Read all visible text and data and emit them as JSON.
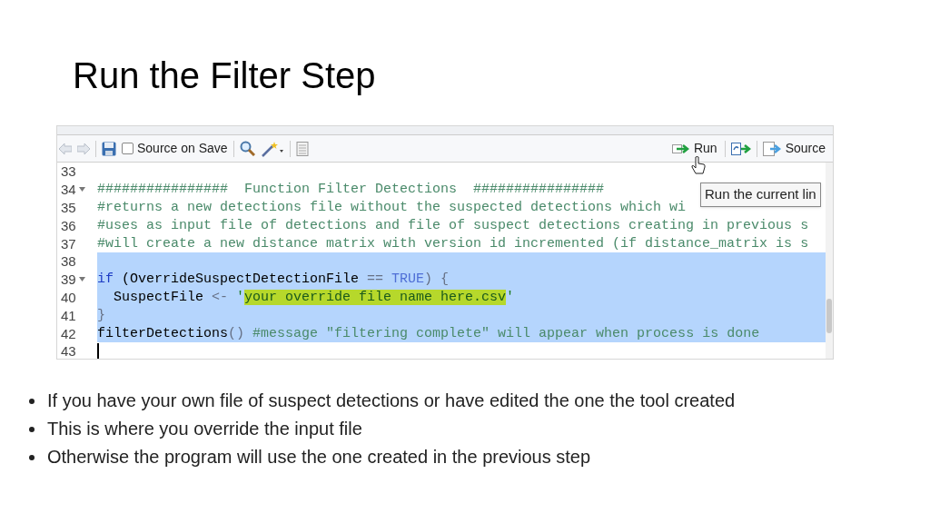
{
  "slide": {
    "title": "Run the Filter Step"
  },
  "editor": {
    "toolbar": {
      "source_on_save": {
        "label": "Source on Save",
        "checked": false
      },
      "run_button": "Run",
      "source_button": "Source",
      "tooltip": "Run the current lin"
    },
    "lines": [
      {
        "number": "33",
        "foldable": false,
        "selected": false
      },
      {
        "number": "34",
        "foldable": true,
        "selected": false,
        "tokens": [
          {
            "kind": "comment",
            "text": "################  Function Filter Detections  ################"
          }
        ]
      },
      {
        "number": "35",
        "foldable": false,
        "selected": false,
        "tokens": [
          {
            "kind": "comment",
            "text": "#returns a new detections file without the suspected detections which wi"
          }
        ]
      },
      {
        "number": "36",
        "foldable": false,
        "selected": false,
        "tokens": [
          {
            "kind": "comment",
            "text": "#uses as input file of detections and file of suspect detections creating in previous s"
          }
        ]
      },
      {
        "number": "37",
        "foldable": false,
        "selected": false,
        "tokens": [
          {
            "kind": "comment",
            "text": "#will create a new distance matrix with version id incremented (if distance_matrix is s"
          }
        ]
      },
      {
        "number": "38",
        "foldable": false,
        "selected": true
      },
      {
        "number": "39",
        "foldable": true,
        "selected": true,
        "tokens": [
          {
            "kind": "keyword",
            "text": "if"
          },
          {
            "kind": "plain",
            "text": " (OverrideSuspectDetectionFile "
          },
          {
            "kind": "operator",
            "text": "=="
          },
          {
            "kind": "constant",
            "text": " TRUE"
          },
          {
            "kind": "operator",
            "text": ") {"
          }
        ]
      },
      {
        "number": "40",
        "foldable": false,
        "selected": true,
        "tokens": [
          {
            "kind": "plain",
            "text": "  SuspectFile "
          },
          {
            "kind": "operator",
            "text": "<-"
          },
          {
            "kind": "string",
            "text": " '"
          },
          {
            "kind": "highlight",
            "text": "your override file name here.csv"
          },
          {
            "kind": "string",
            "text": "'"
          }
        ]
      },
      {
        "number": "41",
        "foldable": false,
        "selected": true,
        "tokens": [
          {
            "kind": "operator",
            "text": "}"
          }
        ]
      },
      {
        "number": "42",
        "foldable": false,
        "selected": true,
        "tokens": [
          {
            "kind": "plain",
            "text": "filterDetections"
          },
          {
            "kind": "operator",
            "text": "()"
          },
          {
            "kind": "comment",
            "text": " #message \"filtering complete\" will appear when process is done"
          }
        ]
      },
      {
        "number": "43",
        "foldable": false,
        "selected": false,
        "cursor": true
      }
    ]
  },
  "bullets": [
    "If you have your own file of suspect detections or have edited the one the tool created",
    "This is where you override the input file",
    "Otherwise the program will use the one created in the previous step"
  ]
}
